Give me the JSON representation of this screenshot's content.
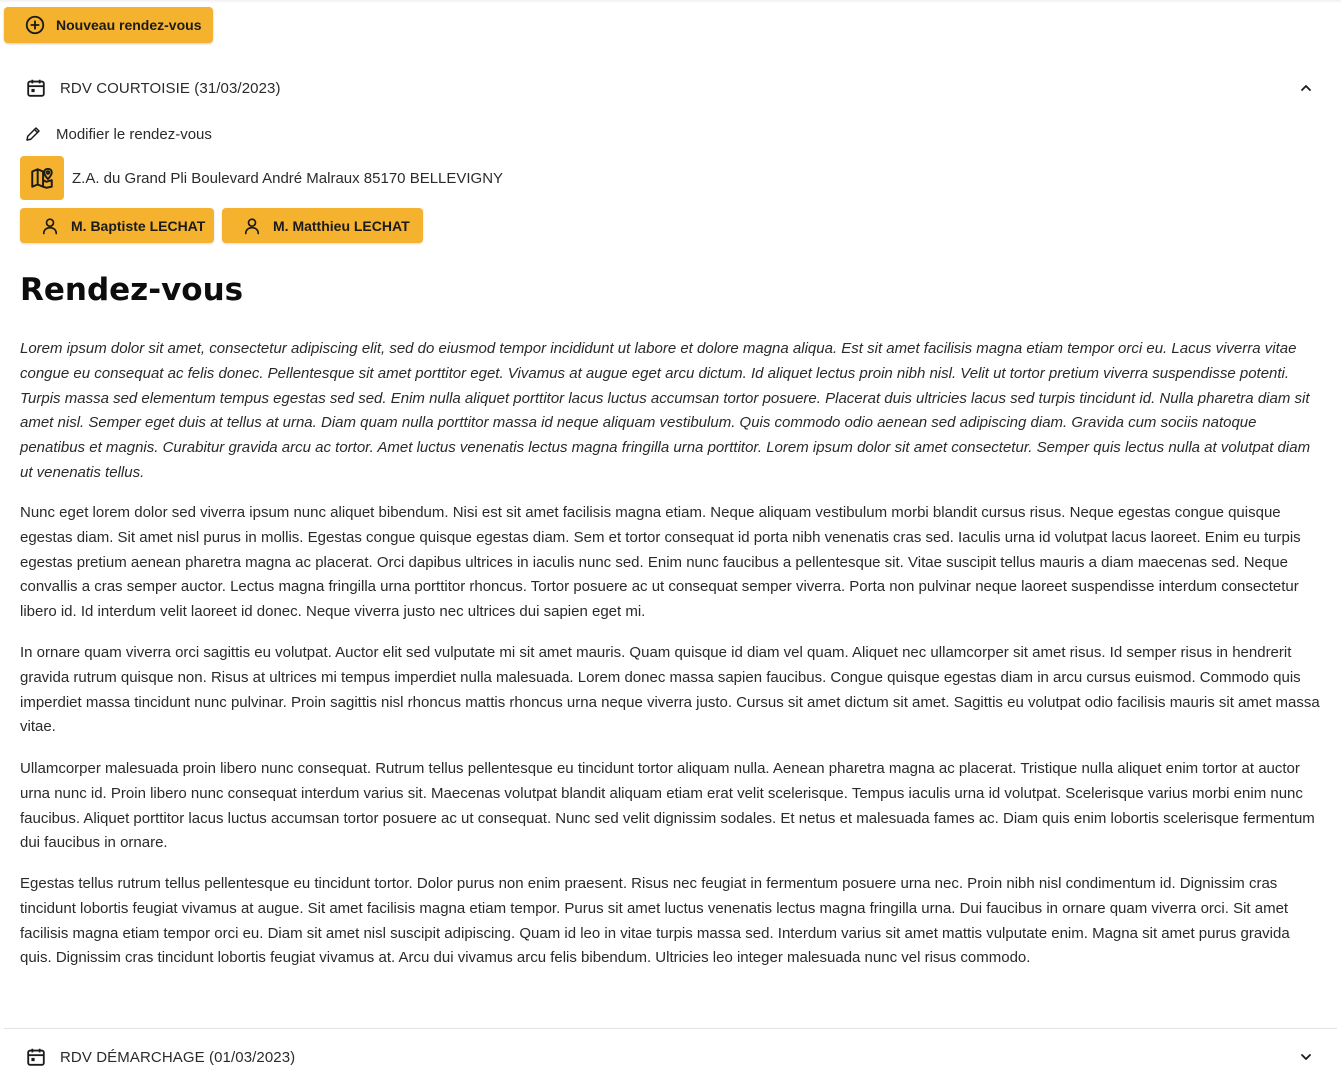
{
  "toolbar": {
    "new_appointment_label": "Nouveau rendez-vous"
  },
  "appointments": [
    {
      "title": "RDV COURTOISIE (31/03/2023)",
      "expanded": true,
      "edit_label": "Modifier le rendez-vous",
      "address": "Z.A. du Grand Pli Boulevard André Malraux 85170 BELLEVIGNY",
      "contacts": [
        "M. Baptiste LECHAT",
        "M. Matthieu LECHAT"
      ],
      "heading": "Rendez-vous",
      "paragraphs": [
        "Lorem ipsum dolor sit amet, consectetur adipiscing elit, sed do eiusmod tempor incididunt ut labore et dolore magna aliqua. Est sit amet facilisis magna etiam tempor orci eu. Lacus viverra vitae congue eu consequat ac felis donec. Pellentesque sit amet porttitor eget. Vivamus at augue eget arcu dictum. Id aliquet lectus proin nibh nisl. Velit ut tortor pretium viverra suspendisse potenti. Turpis massa sed elementum tempus egestas sed sed. Enim nulla aliquet porttitor lacus luctus accumsan tortor posuere. Placerat duis ultricies lacus sed turpis tincidunt id. Nulla pharetra diam sit amet nisl. Semper eget duis at tellus at urna. Diam quam nulla porttitor massa id neque aliquam vestibulum. Quis commodo odio aenean sed adipiscing diam. Gravida cum sociis natoque penatibus et magnis. Curabitur gravida arcu ac tortor. Amet luctus venenatis lectus magna fringilla urna porttitor. Lorem ipsum dolor sit amet consectetur. Semper quis lectus nulla at volutpat diam ut venenatis tellus.",
        "Nunc eget lorem dolor sed viverra ipsum nunc aliquet bibendum. Nisi est sit amet facilisis magna etiam. Neque aliquam vestibulum morbi blandit cursus risus. Neque egestas congue quisque egestas diam. Sit amet nisl purus in mollis. Egestas congue quisque egestas diam. Sem et tortor consequat id porta nibh venenatis cras sed. Iaculis urna id volutpat lacus laoreet. Enim eu turpis egestas pretium aenean pharetra magna ac placerat. Orci dapibus ultrices in iaculis nunc sed. Enim nunc faucibus a pellentesque sit. Vitae suscipit tellus mauris a diam maecenas sed. Neque convallis a cras semper auctor. Lectus magna fringilla urna porttitor rhoncus. Tortor posuere ac ut consequat semper viverra. Porta non pulvinar neque laoreet suspendisse interdum consectetur libero id. Id interdum velit laoreet id donec. Neque viverra justo nec ultrices dui sapien eget mi.",
        "In ornare quam viverra orci sagittis eu volutpat. Auctor elit sed vulputate mi sit amet mauris. Quam quisque id diam vel quam. Aliquet nec ullamcorper sit amet risus. Id semper risus in hendrerit gravida rutrum quisque non. Risus at ultrices mi tempus imperdiet nulla malesuada. Lorem donec massa sapien faucibus. Congue quisque egestas diam in arcu cursus euismod. Commodo quis imperdiet massa tincidunt nunc pulvinar. Proin sagittis nisl rhoncus mattis rhoncus urna neque viverra justo. Cursus sit amet dictum sit amet. Sagittis eu volutpat odio facilisis mauris sit amet massa vitae.",
        "Ullamcorper malesuada proin libero nunc consequat. Rutrum tellus pellentesque eu tincidunt tortor aliquam nulla. Aenean pharetra magna ac placerat. Tristique nulla aliquet enim tortor at auctor urna nunc id. Proin libero nunc consequat interdum varius sit. Maecenas volutpat blandit aliquam etiam erat velit scelerisque. Tempus iaculis urna id volutpat. Scelerisque varius morbi enim nunc faucibus. Aliquet porttitor lacus luctus accumsan tortor posuere ac ut consequat. Nunc sed velit dignissim sodales. Et netus et malesuada fames ac. Diam quis enim lobortis scelerisque fermentum dui faucibus in ornare.",
        "Egestas tellus rutrum tellus pellentesque eu tincidunt tortor. Dolor purus non enim praesent. Risus nec feugiat in fermentum posuere urna nec. Proin nibh nisl condimentum id. Dignissim cras tincidunt lobortis feugiat vivamus at augue. Sit amet facilisis magna etiam tempor. Purus sit amet luctus venenatis lectus magna fringilla urna. Dui faucibus in ornare quam viverra orci. Sit amet facilisis magna etiam tempor orci eu. Diam sit amet nisl suscipit adipiscing. Quam id leo in vitae turpis massa sed. Interdum varius sit amet mattis vulputate enim. Magna sit amet purus gravida quis. Dignissim cras tincidunt lobortis feugiat vivamus at. Arcu dui vivamus arcu felis bibendum. Ultricies leo integer malesuada nunc vel risus commodo."
      ]
    },
    {
      "title": "RDV DÉMARCHAGE (01/03/2023)",
      "expanded": false
    }
  ],
  "icons": {
    "new_button": "plus-circle-icon",
    "appointment": "calendar-icon",
    "expanded": "chevron-up-icon",
    "collapsed": "chevron-down-icon",
    "edit": "pencil-icon",
    "address": "map-pin-icon",
    "contact": "user-icon"
  },
  "colors": {
    "accent": "#f4b22e",
    "text": "#2a2a2a",
    "heading": "#0d0d0d",
    "divider": "#e3e3e3"
  }
}
